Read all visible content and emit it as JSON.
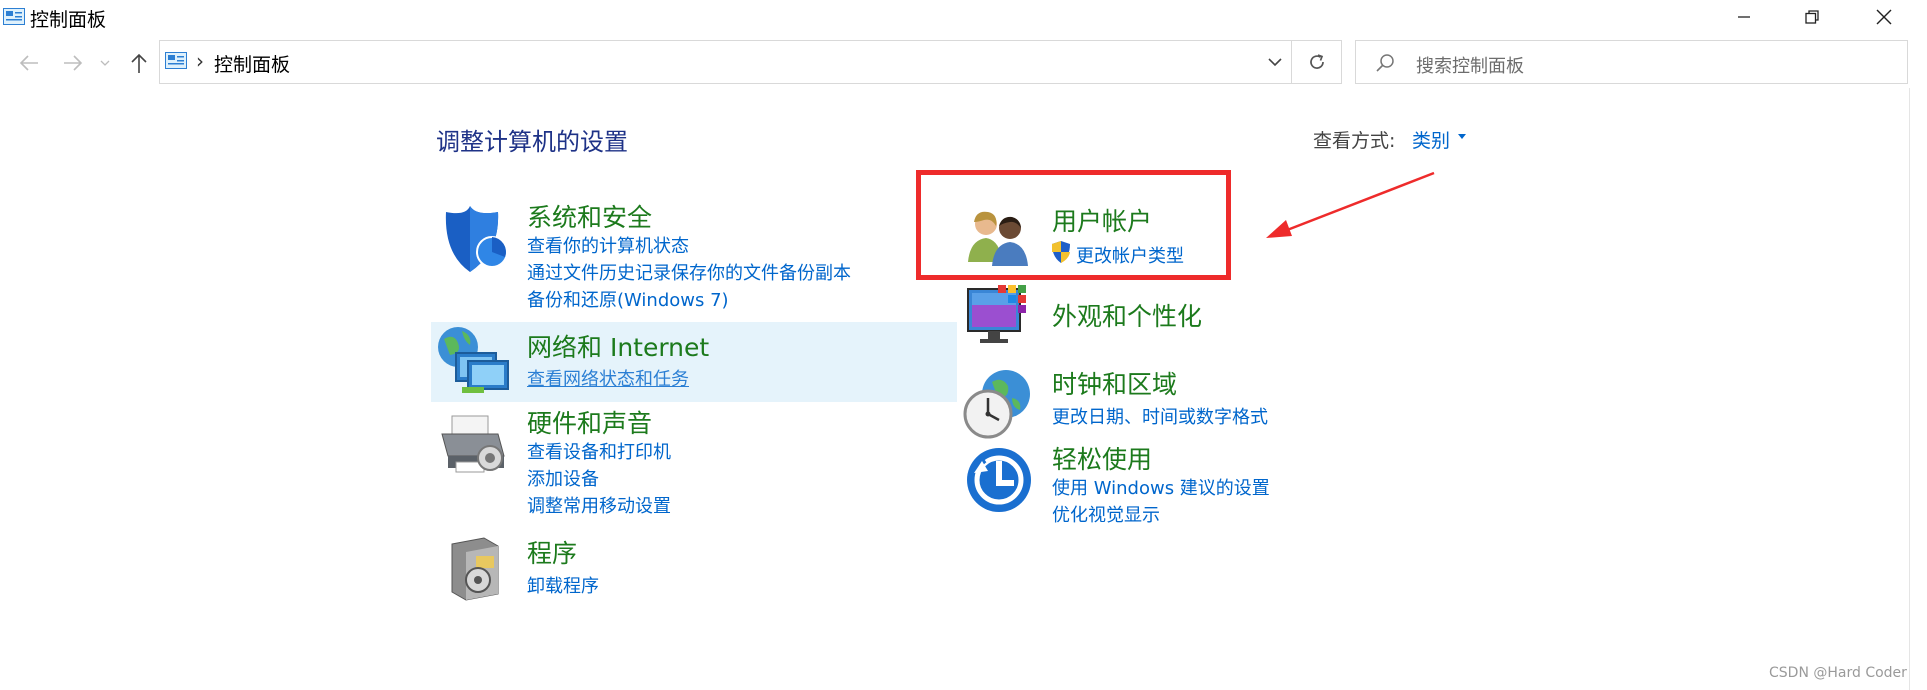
{
  "window": {
    "title": "控制面板",
    "app_icon": "control-panel-icon",
    "controls": [
      "minimize-icon",
      "restore-icon",
      "close-icon"
    ]
  },
  "address_bar": {
    "breadcrumb": "控制面板",
    "search_placeholder": "搜索控制面板"
  },
  "main": {
    "heading": "调整计算机的设置",
    "view_by_label": "查看方式:",
    "view_by_value": "类别"
  },
  "categories_left": [
    {
      "title": "系统和安全",
      "icon": "shield-icon",
      "links": [
        "查看你的计算机状态",
        "通过文件历史记录保存你的文件备份副本",
        "备份和还原(Windows 7)"
      ]
    },
    {
      "title": "网络和 Internet",
      "icon": "network-icon",
      "links": [
        "查看网络状态和任务"
      ]
    },
    {
      "title": "硬件和声音",
      "icon": "printer-icon",
      "links": [
        "查看设备和打印机",
        "添加设备",
        "调整常用移动设置"
      ]
    },
    {
      "title": "程序",
      "icon": "programs-icon",
      "links": [
        "卸载程序"
      ]
    }
  ],
  "categories_right": [
    {
      "title": "用户帐户",
      "icon": "users-icon",
      "links": [
        "更改帐户类型"
      ]
    },
    {
      "title": "外观和个性化",
      "icon": "monitor-icon",
      "links": []
    },
    {
      "title": "时钟和区域",
      "icon": "clock-globe-icon",
      "links": [
        "更改日期、时间或数字格式"
      ]
    },
    {
      "title": "轻松使用",
      "icon": "ease-of-access-icon",
      "links": [
        "使用 Windows 建议的设置",
        "优化视觉显示"
      ]
    }
  ],
  "annotation": {
    "highlight_color": "#ee2b2b"
  },
  "watermark": "CSDN @Hard Coder",
  "colors": {
    "category_title": "#1c7a1c",
    "link": "#0066cc",
    "heading": "#1e3287"
  }
}
